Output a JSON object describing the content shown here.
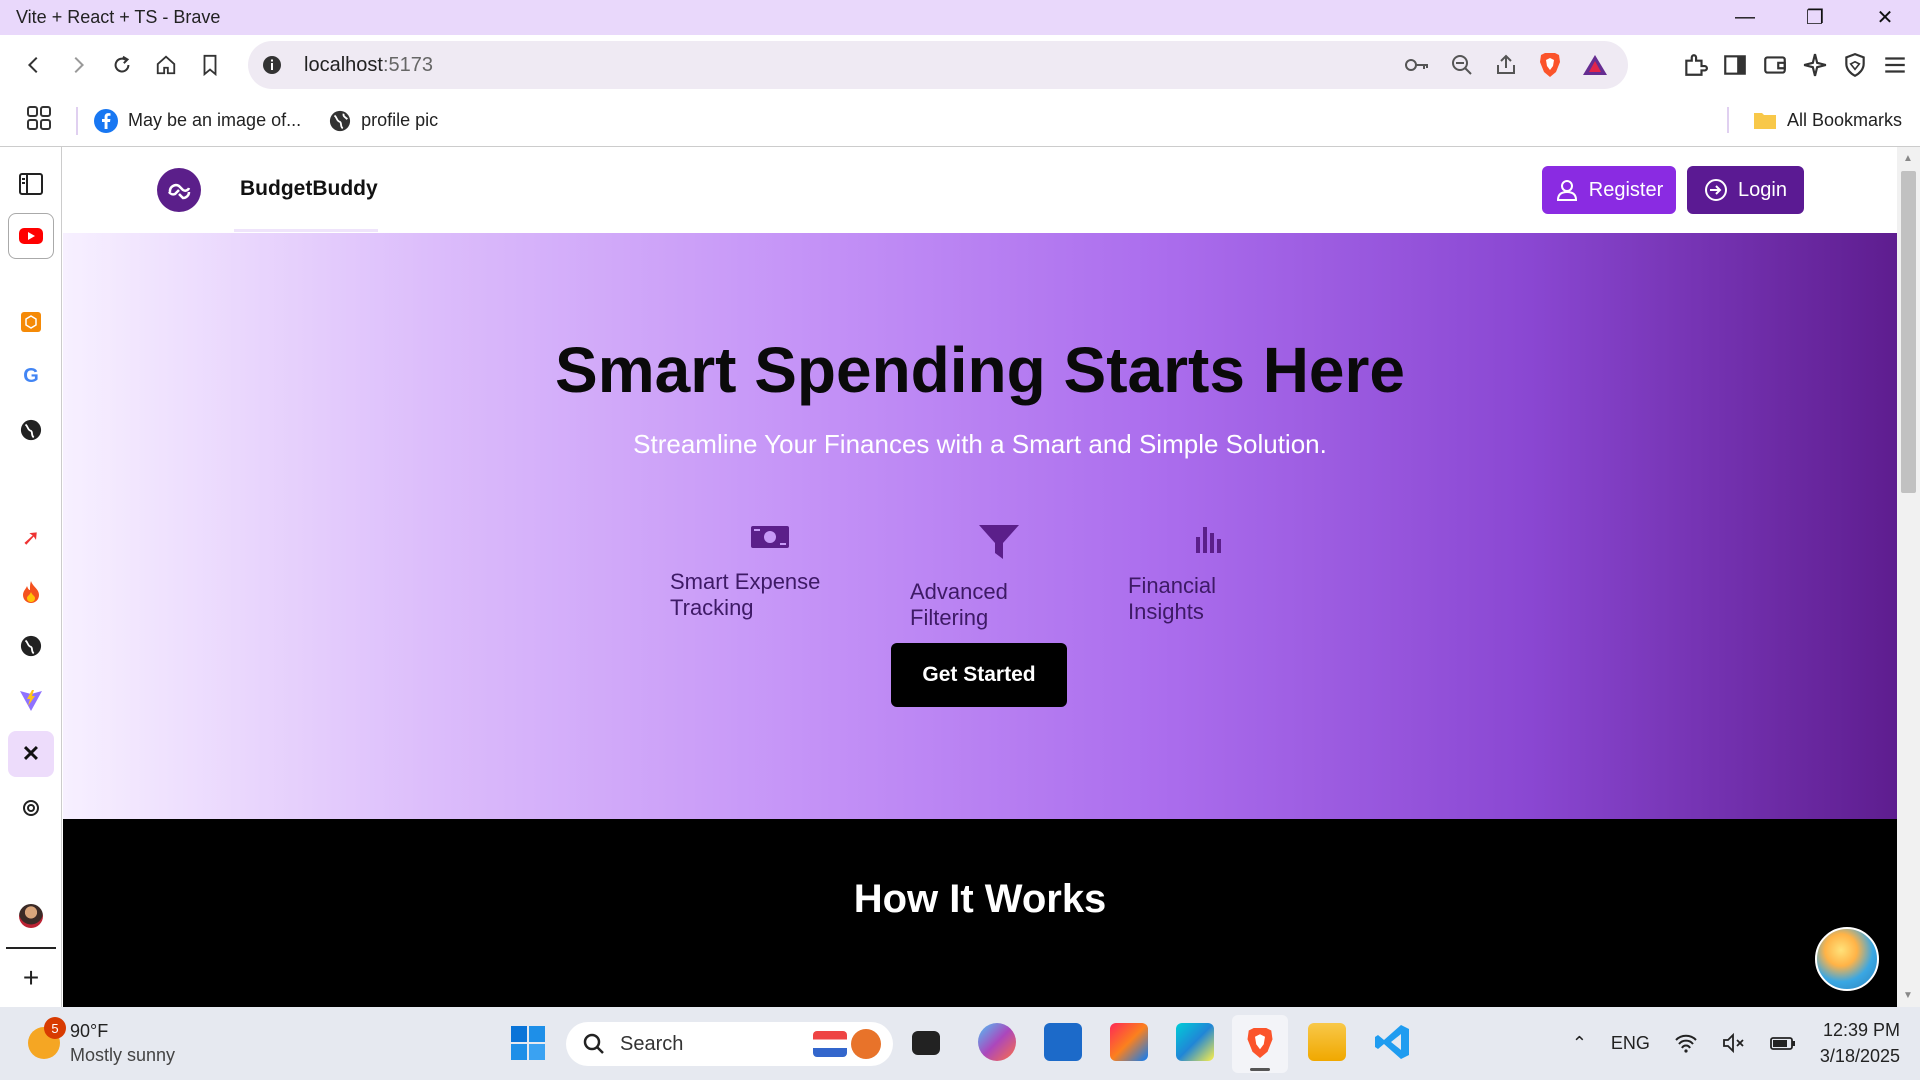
{
  "window": {
    "title": "Vite + React + TS - Brave"
  },
  "address_bar": {
    "host": "localhost",
    "port": ":5173"
  },
  "bookmarks": {
    "items": [
      "May be an image of...",
      "profile pic"
    ],
    "all_label": "All Bookmarks"
  },
  "app": {
    "brand": "BudgetBuddy",
    "register_label": "Register",
    "login_label": "Login",
    "hero_title": "Smart Spending Starts Here",
    "hero_subtitle": "Streamline Your Finances with a Smart and Simple Solution.",
    "features": [
      "Smart Expense Tracking",
      "Advanced Filtering",
      "Financial Insights"
    ],
    "cta_label": "Get Started",
    "how_title": "How It Works"
  },
  "taskbar": {
    "weather_badge": "5",
    "temperature": "90°F",
    "condition": "Mostly sunny",
    "search_placeholder": "Search",
    "language": "ENG",
    "time": "12:39 PM",
    "date": "3/18/2025"
  },
  "colors": {
    "brand_purple": "#8a2be2",
    "login_purple": "#5b1a93",
    "titlebar": "#e9d8fb"
  }
}
